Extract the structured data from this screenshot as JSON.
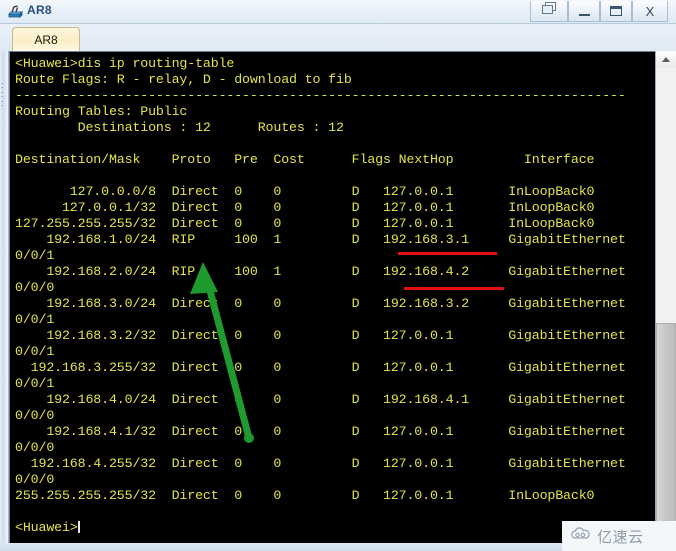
{
  "window": {
    "title": "AR8",
    "icon": "router-device-icon",
    "controls": {
      "restore": "restore-window",
      "minimize": "minimize-window",
      "maximize": "maximize-window",
      "close": "X"
    }
  },
  "tabs": [
    {
      "label": "AR8",
      "active": true
    }
  ],
  "terminal": {
    "prompt_top": "<Huawei>",
    "command": "dis ip routing-table",
    "route_flags": "Route Flags: R - relay, D - download to fib",
    "separator": "------------------------------------------------------------------------------",
    "routing_tables": "Routing Tables: Public",
    "destinations_label": "Destinations",
    "destinations_count": "12",
    "routes_label": "Routes",
    "routes_count": "12",
    "columns": [
      "Destination/Mask",
      "Proto",
      "Pre",
      "Cost",
      "Flags",
      "NextHop",
      "Interface"
    ],
    "prompt_bottom": "<Huawei>",
    "full_text": "<Huawei>dis ip routing-table\nRoute Flags: R - relay, D - download to fib\n------------------------------------------------------------------------------\nRouting Tables: Public\n         Destinations : 12       Routes : 12\n\nDestination/Mask    Proto   Pre  Cost      Flags NextHop         Interface\n\n      127.0.0.0/8   Direct  0    0           D   127.0.0.1       InLoopBack0\n      127.0.0.1/32  Direct  0    0           D   127.0.0.1       InLoopBack0\n127.255.255.255/32  Direct  0    0           D   127.0.0.1       InLoopBack0\n    192.168.1.0/24  RIP     100  1           D   192.168.3.1     GigabitEthernet\n0/0/1\n    192.168.2.0/24  RIP     100  1           D   192.168.4.2     GigabitEthernet\n0/0/0\n    192.168.3.0/24  Direct  0    0           D   192.168.3.2     GigabitEthernet\n0/0/1\n    192.168.3.2/32  Direct  0    0           D   127.0.0.1       GigabitEthernet\n0/0/1\n  192.168.3.255/32  Direct  0    0           D   127.0.0.1       GigabitEthernet\n0/0/1\n    192.168.4.0/24  Direct  0    0           D   192.168.4.1     GigabitEthernet\n0/0/0\n    192.168.4.1/32  Direct  0    0           D   127.0.0.1       GigabitEthernet\n0/0/0\n  192.168.4.255/32  Direct  0    0           D   127.0.0.1       GigabitEthernet\n0/0/0\n255.255.255.255/32  Direct  0    0           D   127.0.0.1       InLoopBack0\n",
    "routes": [
      {
        "destination": "127.0.0.0/8",
        "proto": "Direct",
        "pre": "0",
        "cost": "0",
        "flags": "D",
        "nexthop": "127.0.0.1",
        "interface": "InLoopBack0"
      },
      {
        "destination": "127.0.0.1/32",
        "proto": "Direct",
        "pre": "0",
        "cost": "0",
        "flags": "D",
        "nexthop": "127.0.0.1",
        "interface": "InLoopBack0"
      },
      {
        "destination": "127.255.255.255/32",
        "proto": "Direct",
        "pre": "0",
        "cost": "0",
        "flags": "D",
        "nexthop": "127.0.0.1",
        "interface": "InLoopBack0"
      },
      {
        "destination": "192.168.1.0/24",
        "proto": "RIP",
        "pre": "100",
        "cost": "1",
        "flags": "D",
        "nexthop": "192.168.3.1",
        "interface": "GigabitEthernet0/0/1"
      },
      {
        "destination": "192.168.2.0/24",
        "proto": "RIP",
        "pre": "100",
        "cost": "1",
        "flags": "D",
        "nexthop": "192.168.4.2",
        "interface": "GigabitEthernet0/0/0"
      },
      {
        "destination": "192.168.3.0/24",
        "proto": "Direct",
        "pre": "0",
        "cost": "0",
        "flags": "D",
        "nexthop": "192.168.3.2",
        "interface": "GigabitEthernet0/0/1"
      },
      {
        "destination": "192.168.3.2/32",
        "proto": "Direct",
        "pre": "0",
        "cost": "0",
        "flags": "D",
        "nexthop": "127.0.0.1",
        "interface": "GigabitEthernet0/0/1"
      },
      {
        "destination": "192.168.3.255/32",
        "proto": "Direct",
        "pre": "0",
        "cost": "0",
        "flags": "D",
        "nexthop": "127.0.0.1",
        "interface": "GigabitEthernet0/0/1"
      },
      {
        "destination": "192.168.4.0/24",
        "proto": "Direct",
        "pre": "0",
        "cost": "0",
        "flags": "D",
        "nexthop": "192.168.4.1",
        "interface": "GigabitEthernet0/0/0"
      },
      {
        "destination": "192.168.4.1/32",
        "proto": "Direct",
        "pre": "0",
        "cost": "0",
        "flags": "D",
        "nexthop": "127.0.0.1",
        "interface": "GigabitEthernet0/0/0"
      },
      {
        "destination": "192.168.4.255/32",
        "proto": "Direct",
        "pre": "0",
        "cost": "0",
        "flags": "D",
        "nexthop": "127.0.0.1",
        "interface": "GigabitEthernet0/0/0"
      },
      {
        "destination": "255.255.255.255/32",
        "proto": "Direct",
        "pre": "0",
        "cost": "0",
        "flags": "D",
        "nexthop": "127.0.0.1",
        "interface": "InLoopBack0"
      }
    ]
  },
  "annotations": {
    "arrow": {
      "name": "green-arrow",
      "color": "#1f9a2e",
      "points_to": "RIP"
    },
    "underlines": [
      {
        "name": "red-underline-nexthop-1",
        "target": "192.168.3.1",
        "color": "#e01010"
      },
      {
        "name": "red-underline-nexthop-2",
        "target": "192.168.4.2",
        "color": "#e01010"
      }
    ]
  },
  "scrollbar": {
    "up_arrow": "scroll-up-arrow"
  },
  "watermark": {
    "text": "亿速云",
    "icon": "cloud-icon"
  },
  "colors": {
    "terminal_bg": "#000000",
    "terminal_fg": "#e3e34a",
    "accent_red": "#e01010",
    "accent_green": "#1f9a2e",
    "title_text": "#29507d"
  }
}
